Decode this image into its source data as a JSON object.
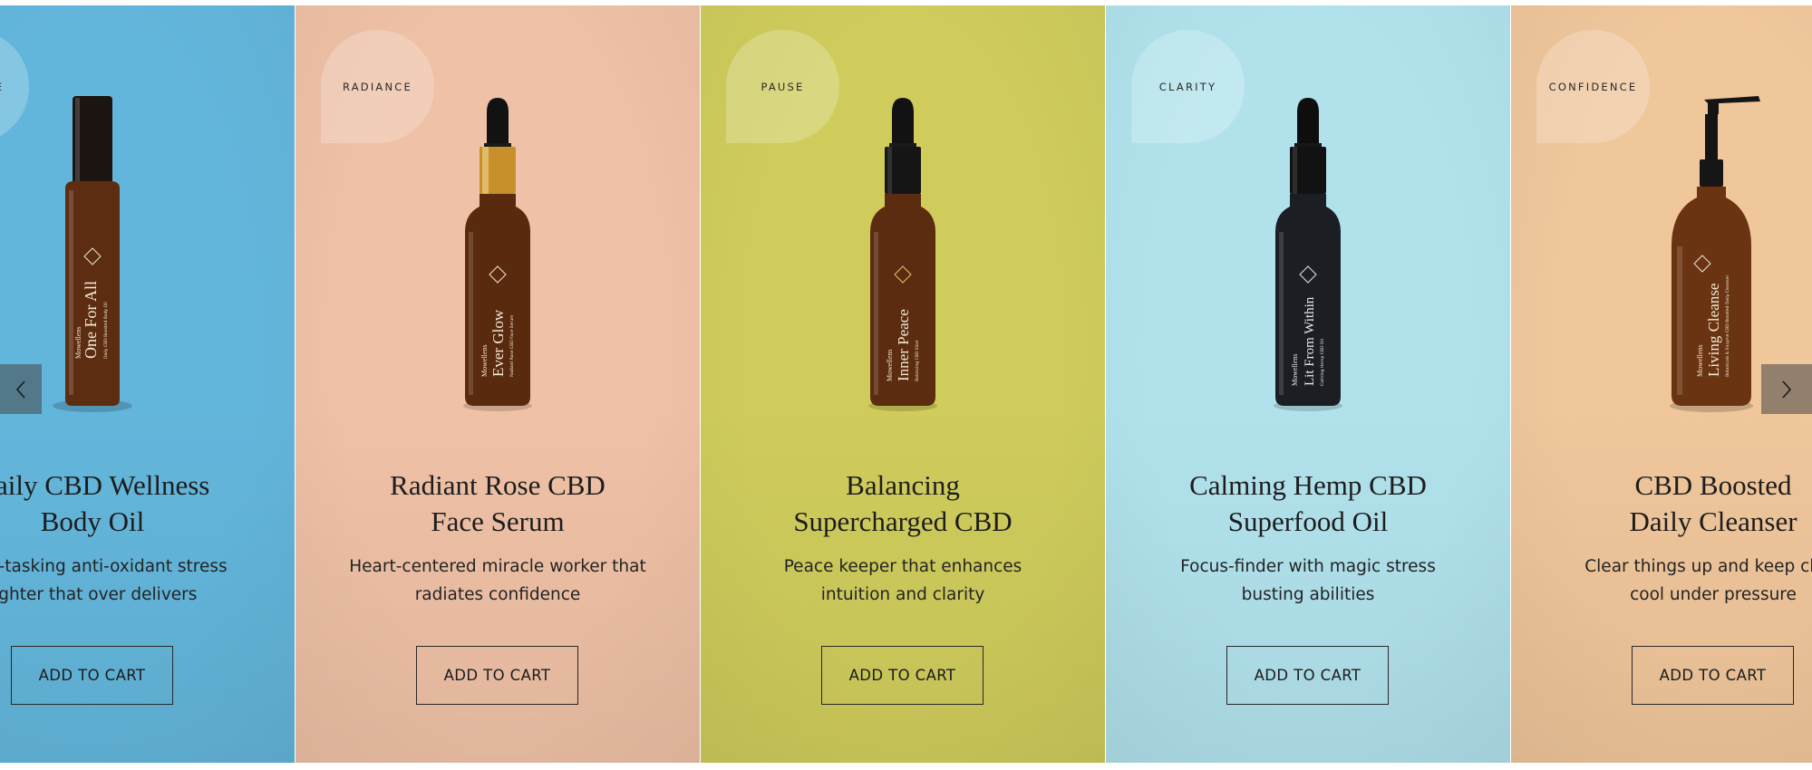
{
  "carousel": {
    "prev_icon": "chevron-left-icon",
    "next_icon": "chevron-right-icon",
    "products": [
      {
        "badge": "BALANCE",
        "title_line1": "Daily CBD Wellness",
        "title_line2": "Body Oil",
        "desc_line1": "Multi-tasking anti-oxidant stress",
        "desc_line2": "fighter that over delivers",
        "cta": "ADD TO CART",
        "bottle_brand": "Mowellens",
        "bottle_name": "One For All",
        "bottle_sub": "Daily CBD-Boosted Body Oil",
        "bg_color": "#63b6db",
        "bottle_type": "tall"
      },
      {
        "badge": "RADIANCE",
        "title_line1": "Radiant Rose CBD",
        "title_line2": "Face Serum",
        "desc_line1": "Heart-centered miracle worker that",
        "desc_line2": "radiates confidence",
        "cta": "ADD TO CART",
        "bottle_brand": "Mowellens",
        "bottle_name": "Ever Glow",
        "bottle_sub": "Radiant Rose CBD Face Serum",
        "bg_color": "#efc1a6",
        "bottle_type": "dropper-gold"
      },
      {
        "badge": "PAUSE",
        "title_line1": "Balancing",
        "title_line2": "Supercharged CBD",
        "desc_line1": "Peace keeper that enhances",
        "desc_line2": "intuition and clarity",
        "cta": "ADD TO CART",
        "bottle_brand": "Mowellens",
        "bottle_name": "Inner Peace",
        "bottle_sub": "Balancing CBD Elixir",
        "bg_color": "#cfcc5c",
        "bottle_type": "dropper"
      },
      {
        "badge": "CLARITY",
        "title_line1": "Calming Hemp CBD",
        "title_line2": "Superfood Oil",
        "desc_line1": "Focus-finder with magic stress",
        "desc_line2": "busting abilities",
        "cta": "ADD TO CART",
        "bottle_brand": "Mowellens",
        "bottle_name": "Lit From Within",
        "bottle_sub": "Calming Hemp CBD Oil",
        "bg_color": "#b1e2ec",
        "bottle_type": "dropper-dark"
      },
      {
        "badge": "CONFIDENCE",
        "title_line1": "CBD Boosted",
        "title_line2": "Daily Cleanser",
        "desc_line1": "Clear things up and keep clear",
        "desc_line2": "cool under pressure",
        "cta": "ADD TO CART",
        "bottle_brand": "Mowellens",
        "bottle_name": "Living Cleanse",
        "bottle_sub": "Botanicals & Enzyme CBD Boosted Daily Cleanser",
        "bg_color": "#f0c69b",
        "bottle_type": "pump"
      }
    ]
  }
}
